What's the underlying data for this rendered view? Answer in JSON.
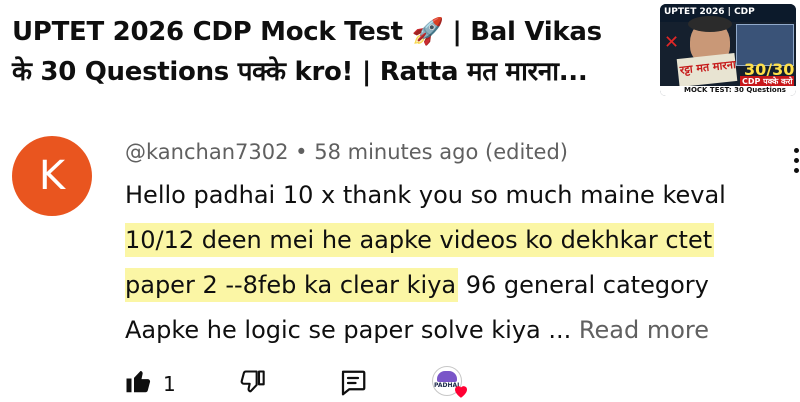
{
  "video": {
    "title_line1": "UPTET 2026 CDP Mock Test 🚀 | Bal Vikas",
    "title_line2": "के 30 Questions पक्के kro! | Ratta मत मारना...",
    "thumbnail": {
      "top_label": "UPTET 2026 | CDP",
      "stamp": "रट्टा मत मारना",
      "count": "30/30",
      "sub": "CDP पक्के करो",
      "banner": "MOCK TEST: 30 Questions"
    }
  },
  "comment": {
    "avatar_letter": "K",
    "avatar_color": "#e9551f",
    "author": "@kanchan7302",
    "separator": "•",
    "time": "58 minutes ago (edited)",
    "text_line1": "Hello padhai 10 x thank you so much maine keval",
    "highlight_line1": "10/12 deen mei he aapke videos ko dekhkar ctet",
    "highlight_line2": "paper 2 --8feb ka clear kiya",
    "text_after_highlight": " 96 general category",
    "text_line4": "Aapke he logic se paper solve kiya ...",
    "read_more": "Read more",
    "like_count": "1",
    "creator_badge": "PADHAI",
    "highlight_color": "#fbf6a5"
  },
  "icons": {
    "like": "thumb-up-filled-icon",
    "dislike": "thumb-down-icon",
    "reply": "comment-reply-icon",
    "heart": "creator-heart-icon",
    "menu": "more-vert-icon"
  }
}
